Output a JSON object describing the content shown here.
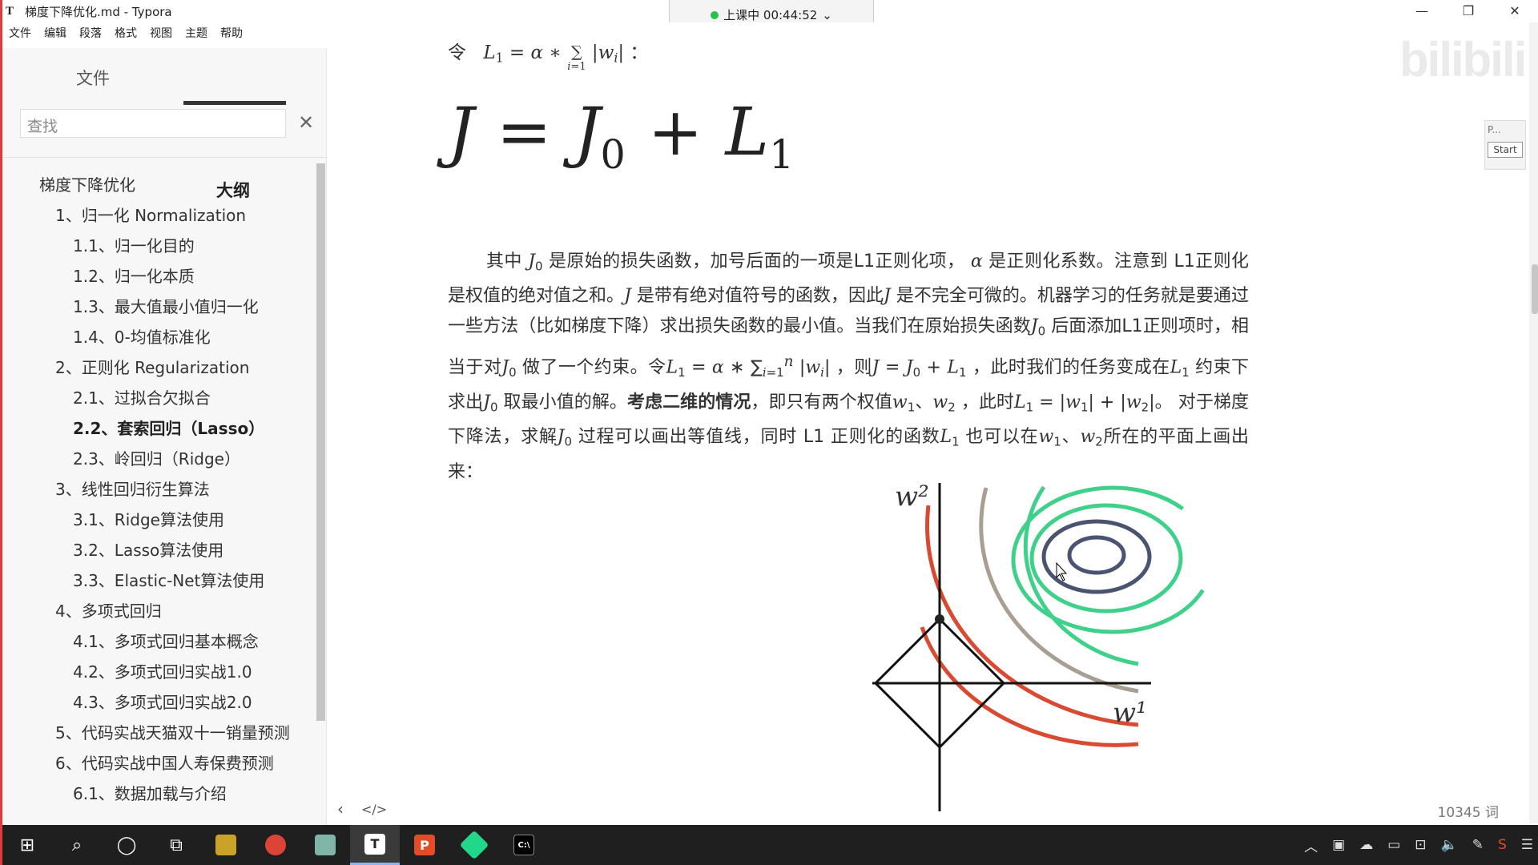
{
  "window": {
    "title": "梯度下降优化.md - Typora",
    "app_icon": "T"
  },
  "timer": {
    "label": "上课中 00:44:52",
    "chevron": "⌄"
  },
  "menu": [
    "文件",
    "编辑",
    "段落",
    "格式",
    "视图",
    "主题",
    "帮助"
  ],
  "sidebar": {
    "tab_files": "文件",
    "tab_outline": "大纲",
    "search_placeholder": "查找",
    "outline": [
      {
        "label": "梯度下降优化",
        "level": 1
      },
      {
        "label": "1、归一化 Normalization",
        "level": 2
      },
      {
        "label": "1.1、归一化目的",
        "level": 3
      },
      {
        "label": "1.2、归一化本质",
        "level": 3
      },
      {
        "label": "1.3、最大值最小值归一化",
        "level": 3
      },
      {
        "label": "1.4、0-均值标准化",
        "level": 3
      },
      {
        "label": "2、正则化 Regularization",
        "level": 2
      },
      {
        "label": "2.1、过拟合欠拟合",
        "level": 3
      },
      {
        "label": "2.2、套索回归（Lasso）",
        "level": 3,
        "active": true
      },
      {
        "label": "2.3、岭回归（Ridge）",
        "level": 3
      },
      {
        "label": "3、线性回归衍生算法",
        "level": 2
      },
      {
        "label": "3.1、Ridge算法使用",
        "level": 3
      },
      {
        "label": "3.2、Lasso算法使用",
        "level": 3
      },
      {
        "label": "3.3、Elastic-Net算法使用",
        "level": 3
      },
      {
        "label": "4、多项式回归",
        "level": 2
      },
      {
        "label": "4.1、多项式回归基本概念",
        "level": 3
      },
      {
        "label": "4.2、多项式回归实战1.0",
        "level": 3
      },
      {
        "label": "4.3、多项式回归实战2.0",
        "level": 3
      },
      {
        "label": "5、代码实战天猫双十一销量预测",
        "level": 2,
        "wrap": true
      },
      {
        "label": "6、代码实战中国人寿保费预测",
        "level": 2
      },
      {
        "label": "6.1、数据加载与介绍",
        "level": 3
      }
    ]
  },
  "editor": {
    "top_formula": {
      "prefix": "令",
      "suffix": "："
    },
    "big_equation": "J = J0 + L1",
    "paragraph": {
      "s1": "其中",
      "s2": "是原始的损失函数，加号后面的一项是L1正则化项，",
      "s3": "是正则化系数。注意到 L1正则化是权值的绝对值之和。",
      "s4": "是带有绝对值符号的函数，因此",
      "s5": "是不完全可微的。机器学习的任务就是要通过一些方法（比如梯度下降）求出损失函数的最小值。当我们在原始损失函数",
      "s6": "后面添加L1正则项时，相当于对",
      "s7": "做了一个约束。令",
      "s8": "，则",
      "s9": "，此时我们的任务变成在",
      "s10": "约束下求出",
      "s11": "取最小值的解。",
      "bold": "考虑二维的情况",
      "s12": "，即只有两个权值",
      "s13": "，此时",
      "s14": "。 对于梯度下降法，求解",
      "s15": "过程可以画出等值线，同时 L1 正则化的函数",
      "s16": "也可以在",
      "s17": "所在的平面上画出来："
    },
    "figure": {
      "x_label": "w¹",
      "y_label": "w²"
    },
    "word_count": "10345 词"
  },
  "widget": {
    "p_label": "P...",
    "start_label": "Start"
  },
  "watermark": "bilibili",
  "colors": {
    "accent_border": "#e0393e",
    "contour_green": "#3fd18a",
    "contour_red": "#d94a32",
    "contour_gray": "#a89f92",
    "contour_navy": "#4a5470"
  }
}
